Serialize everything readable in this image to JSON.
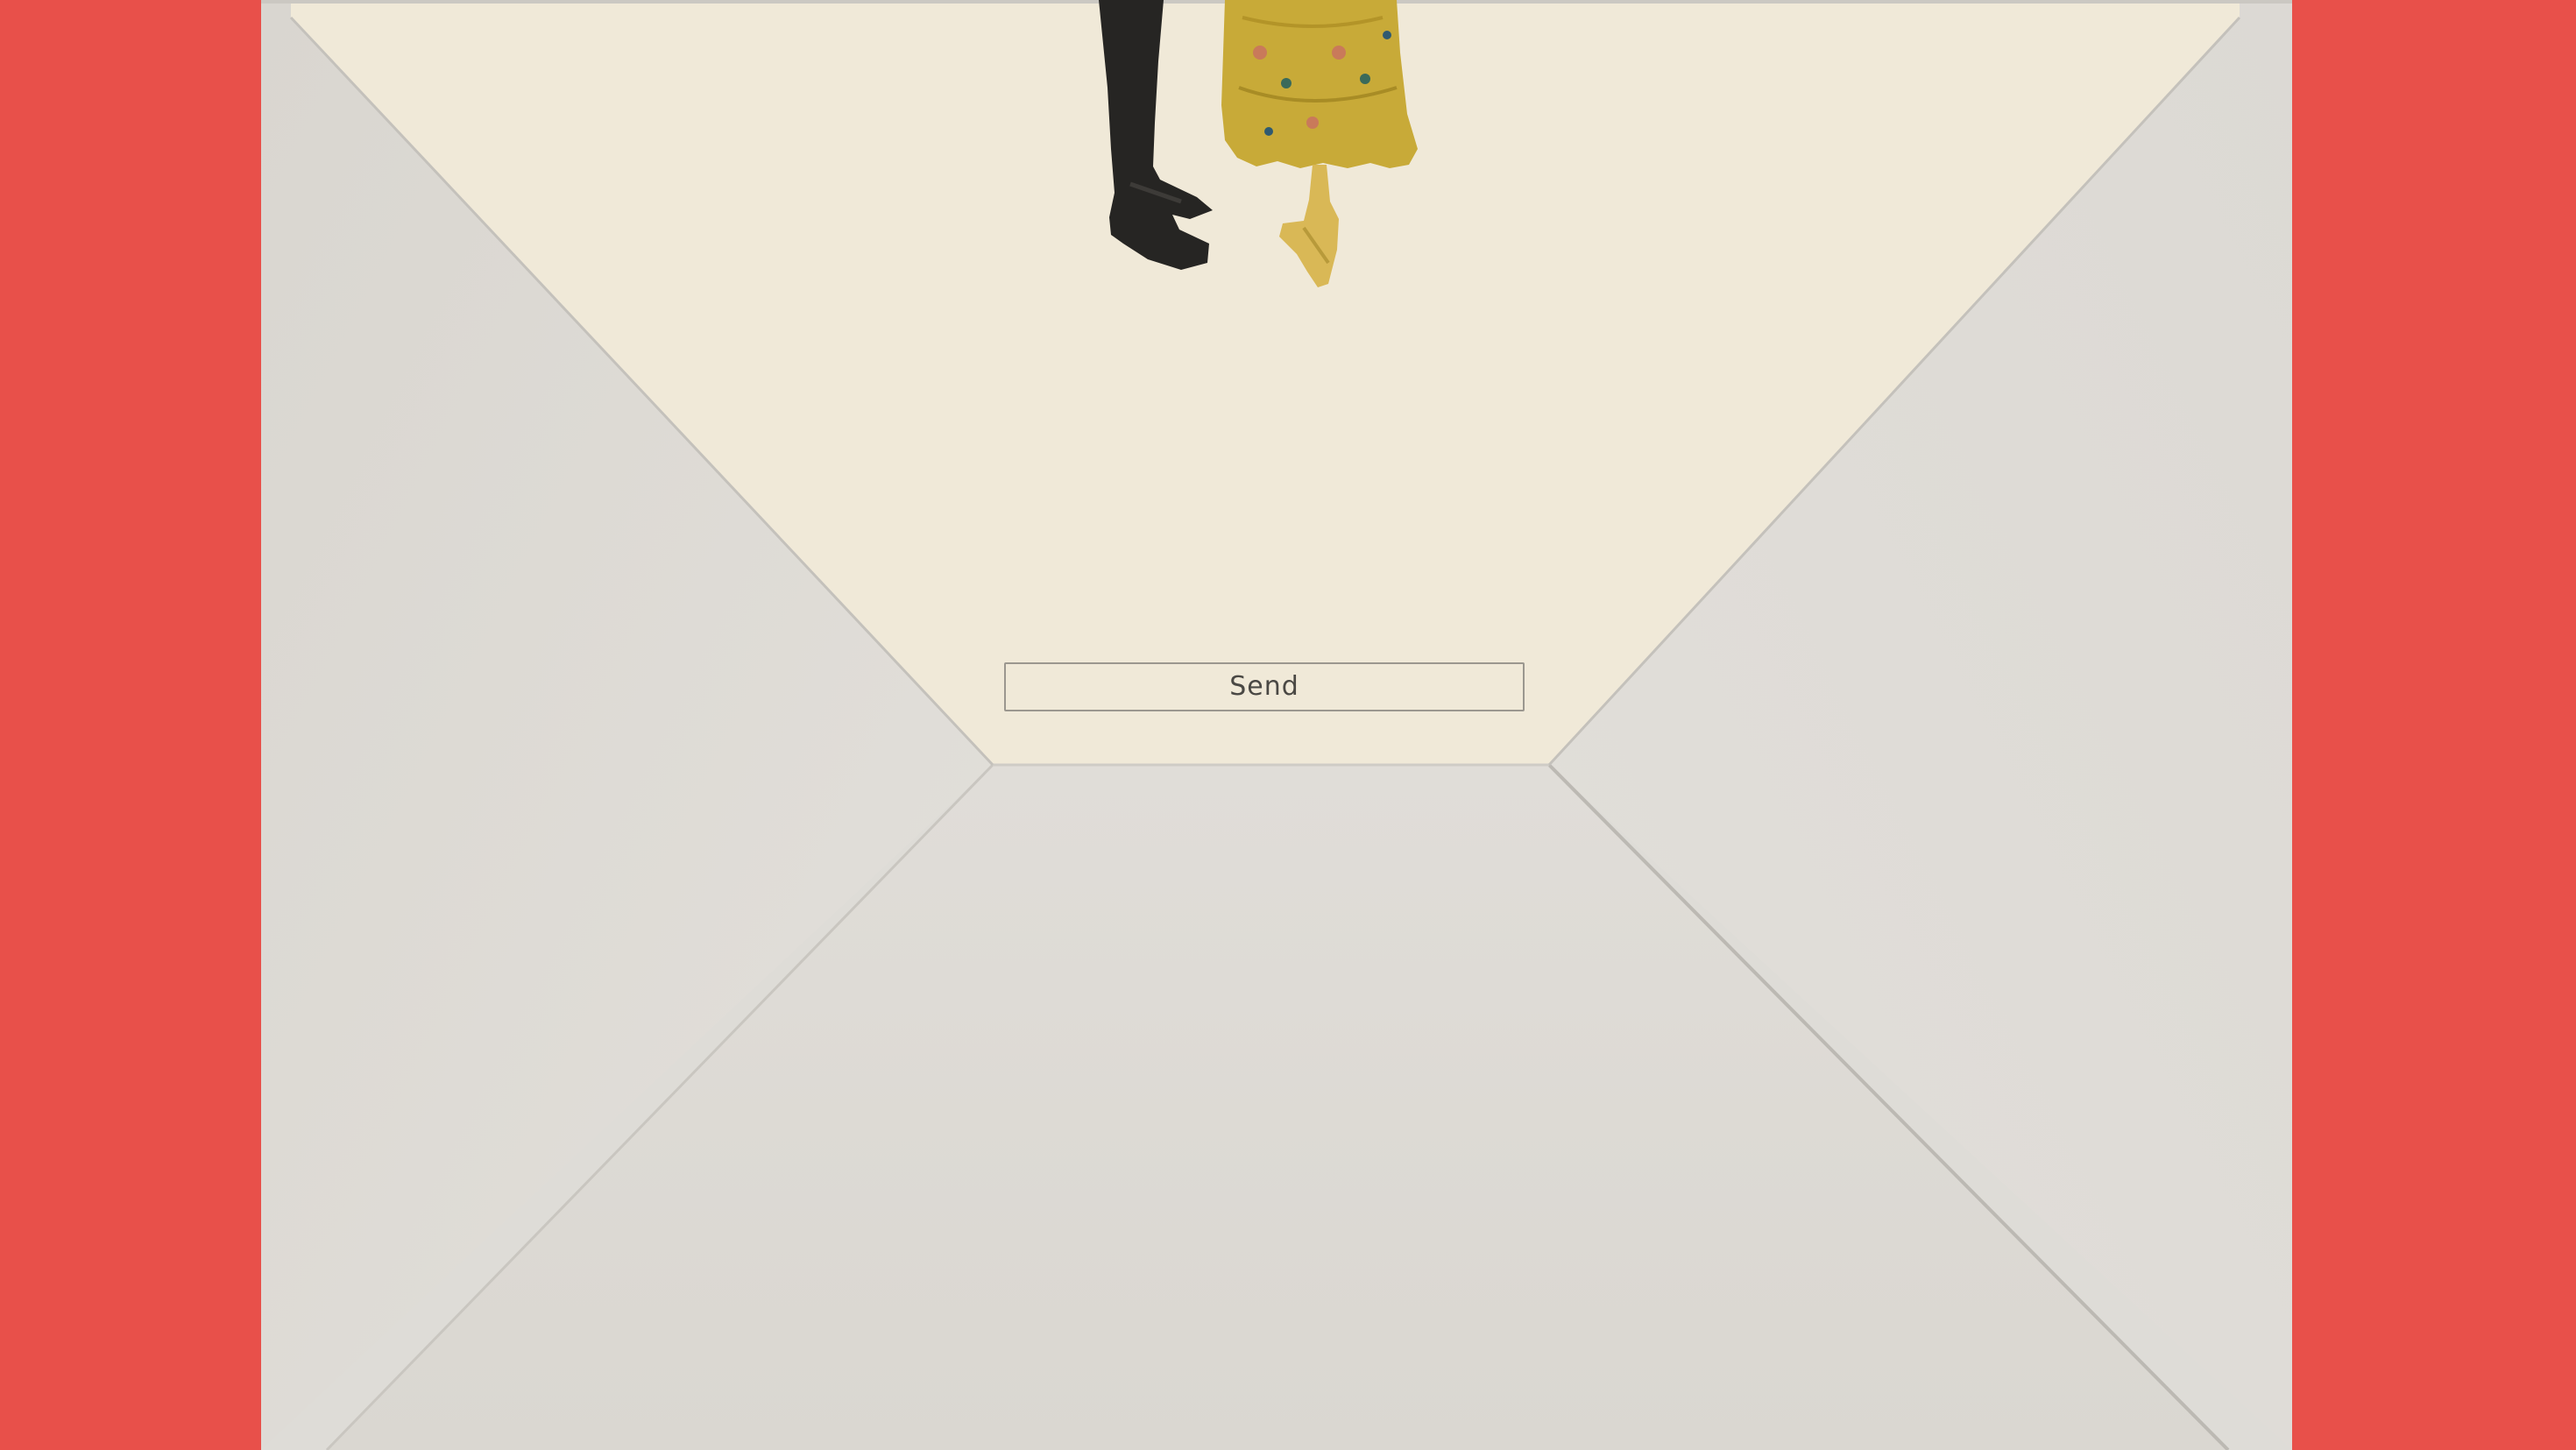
{
  "page": {
    "background_color": "#e8504a",
    "envelope_color": "#dedcd7",
    "card_color": "#f0e9d8"
  },
  "card": {
    "illustration": "dancing-couple-feet-illustration"
  },
  "actions": {
    "send_label": "Send"
  }
}
